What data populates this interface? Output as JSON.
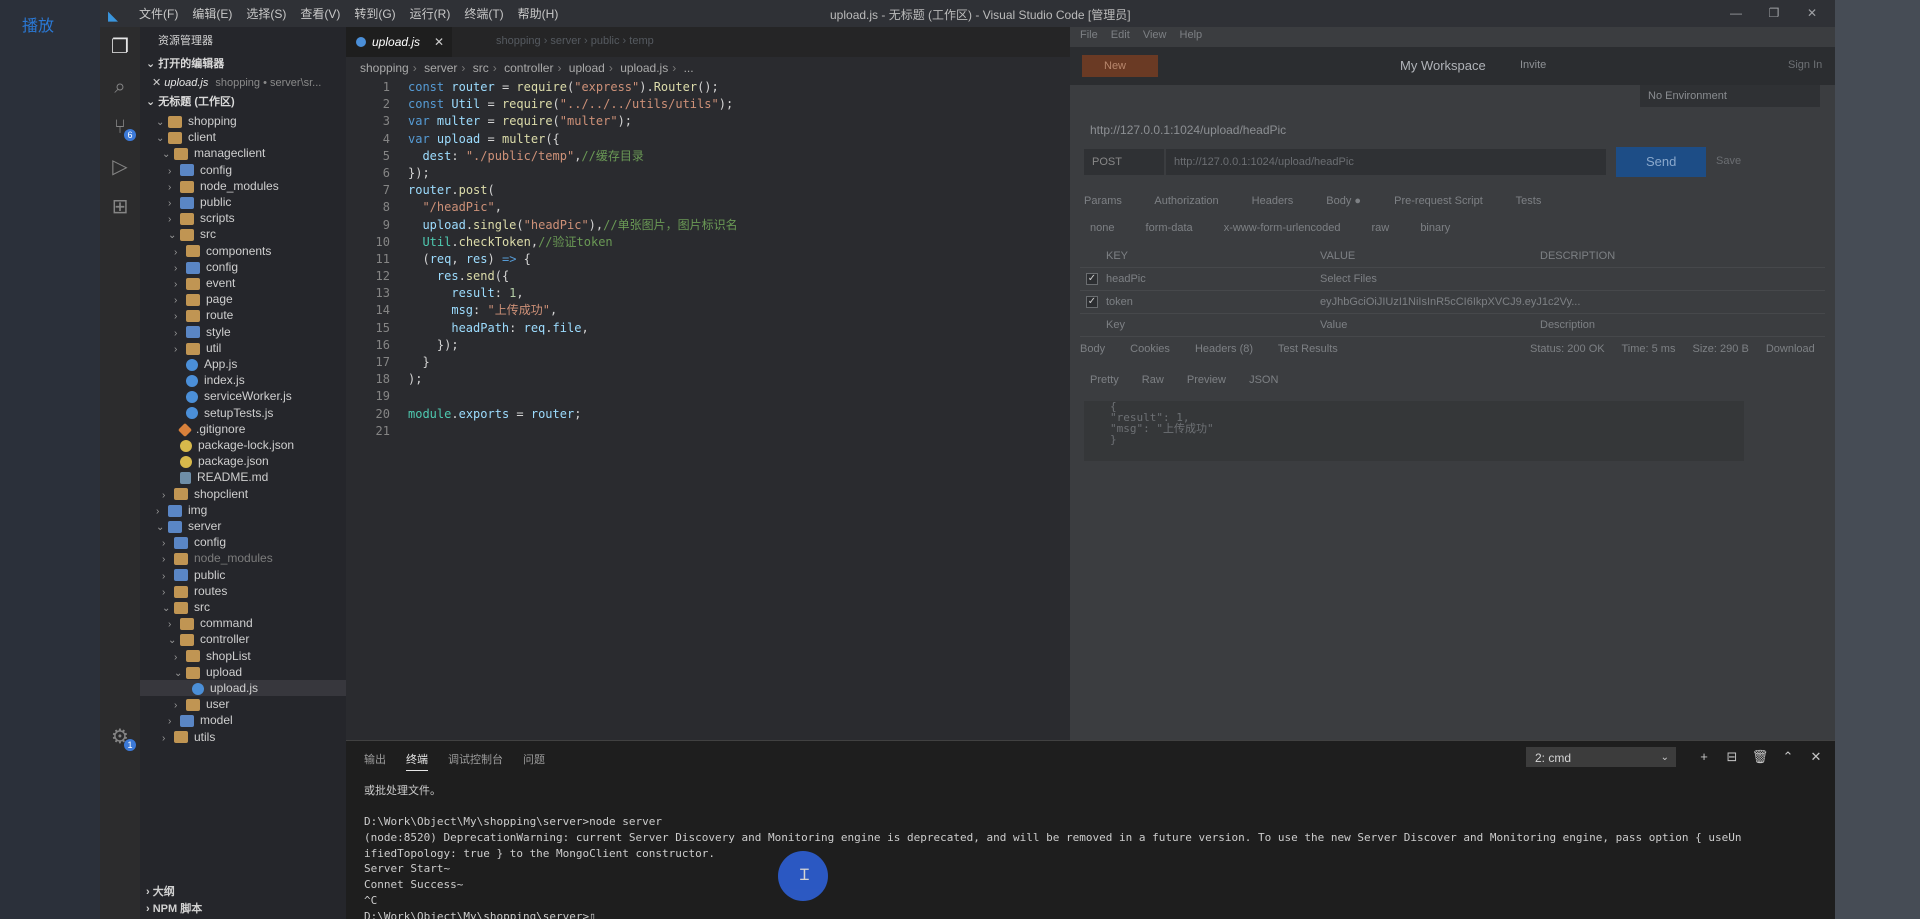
{
  "overlay": {
    "play_label": "播放"
  },
  "titlebar": {
    "menu": [
      "文件(F)",
      "编辑(E)",
      "选择(S)",
      "查看(V)",
      "转到(G)",
      "运行(R)",
      "终端(T)",
      "帮助(H)"
    ],
    "title": "upload.js - 无标题 (工作区) - Visual Studio Code [管理员]",
    "controls": [
      "—",
      "❐",
      "✕"
    ]
  },
  "activitybar": {
    "scm_badge": "6",
    "settings_badge": "1"
  },
  "sidebar": {
    "header": "资源管理器",
    "open_editors_title": "打开的编辑器",
    "open_editor": {
      "name": "upload.js",
      "path": "shopping • server\\sr..."
    },
    "workspace_title": "无标题 (工作区)",
    "tree": [
      {
        "label": "shopping",
        "depth": 1,
        "kind": "folder",
        "chev": "⌄"
      },
      {
        "label": "client",
        "depth": 1,
        "kind": "folder",
        "chev": "⌄"
      },
      {
        "label": "manageclient",
        "depth": 2,
        "kind": "folder",
        "chev": "⌄"
      },
      {
        "label": "config",
        "depth": 3,
        "kind": "folder-blue",
        "chev": "›"
      },
      {
        "label": "node_modules",
        "depth": 3,
        "kind": "folder",
        "chev": "›"
      },
      {
        "label": "public",
        "depth": 3,
        "kind": "folder-blue",
        "chev": "›"
      },
      {
        "label": "scripts",
        "depth": 3,
        "kind": "folder",
        "chev": "›"
      },
      {
        "label": "src",
        "depth": 3,
        "kind": "folder",
        "chev": "⌄"
      },
      {
        "label": "components",
        "depth": 4,
        "kind": "folder",
        "chev": "›"
      },
      {
        "label": "config",
        "depth": 4,
        "kind": "folder-blue",
        "chev": "›"
      },
      {
        "label": "event",
        "depth": 4,
        "kind": "folder",
        "chev": "›"
      },
      {
        "label": "page",
        "depth": 4,
        "kind": "folder",
        "chev": "›"
      },
      {
        "label": "route",
        "depth": 4,
        "kind": "folder",
        "chev": "›"
      },
      {
        "label": "style",
        "depth": 4,
        "kind": "folder-blue",
        "chev": "›"
      },
      {
        "label": "util",
        "depth": 4,
        "kind": "folder",
        "chev": "›"
      },
      {
        "label": "App.js",
        "depth": 4,
        "kind": "js",
        "chev": ""
      },
      {
        "label": "index.js",
        "depth": 4,
        "kind": "js",
        "chev": ""
      },
      {
        "label": "serviceWorker.js",
        "depth": 4,
        "kind": "js",
        "chev": ""
      },
      {
        "label": "setupTests.js",
        "depth": 4,
        "kind": "js",
        "chev": ""
      },
      {
        "label": ".gitignore",
        "depth": 3,
        "kind": "git",
        "chev": ""
      },
      {
        "label": "package-lock.json",
        "depth": 3,
        "kind": "json",
        "chev": ""
      },
      {
        "label": "package.json",
        "depth": 3,
        "kind": "json",
        "chev": ""
      },
      {
        "label": "README.md",
        "depth": 3,
        "kind": "file",
        "chev": ""
      },
      {
        "label": "shopclient",
        "depth": 2,
        "kind": "folder",
        "chev": "›"
      },
      {
        "label": "img",
        "depth": 1,
        "kind": "folder-blue",
        "chev": "›"
      },
      {
        "label": "server",
        "depth": 1,
        "kind": "folder-blue",
        "chev": "⌄"
      },
      {
        "label": "config",
        "depth": 2,
        "kind": "folder-blue",
        "chev": "›"
      },
      {
        "label": "node_modules",
        "depth": 2,
        "kind": "folder",
        "chev": "›",
        "dim": true
      },
      {
        "label": "public",
        "depth": 2,
        "kind": "folder-blue",
        "chev": "›"
      },
      {
        "label": "routes",
        "depth": 2,
        "kind": "folder",
        "chev": "›"
      },
      {
        "label": "src",
        "depth": 2,
        "kind": "folder",
        "chev": "⌄"
      },
      {
        "label": "command",
        "depth": 3,
        "kind": "folder",
        "chev": "›"
      },
      {
        "label": "controller",
        "depth": 3,
        "kind": "folder",
        "chev": "⌄"
      },
      {
        "label": "shopList",
        "depth": 4,
        "kind": "folder",
        "chev": "›"
      },
      {
        "label": "upload",
        "depth": 4,
        "kind": "folder",
        "chev": "⌄"
      },
      {
        "label": "upload.js",
        "depth": 5,
        "kind": "js",
        "chev": "",
        "selected": true
      },
      {
        "label": "user",
        "depth": 4,
        "kind": "folder",
        "chev": "›"
      },
      {
        "label": "model",
        "depth": 3,
        "kind": "folder-blue",
        "chev": "›"
      },
      {
        "label": "utils",
        "depth": 2,
        "kind": "folder",
        "chev": "›"
      }
    ],
    "outline_title": "大纲",
    "npm_title": "NPM 脚本"
  },
  "editor": {
    "tab": {
      "label": "upload.js",
      "close": "✕"
    },
    "ghost_path": "shopping › server › public › temp",
    "breadcrumbs": [
      "shopping",
      "server",
      "src",
      "controller",
      "upload",
      "upload.js",
      "..."
    ],
    "code": [
      "<span class=\"kw\">const</span> <span class=\"var\">router</span> = <span class=\"fn\">require</span>(<span class=\"str\">\"express\"</span>).<span class=\"fn\">Router</span>();",
      "<span class=\"kw\">const</span> <span class=\"var\">Util</span> = <span class=\"fn\">require</span>(<span class=\"str\">\"../../../utils/utils\"</span>);",
      "<span class=\"kw\">var</span> <span class=\"var\">multer</span> = <span class=\"fn\">require</span>(<span class=\"str\">\"multer\"</span>);",
      "<span class=\"kw\">var</span> <span class=\"var\">upload</span> = <span class=\"fn\">multer</span>({",
      "  <span class=\"var\">dest</span>: <span class=\"str\">\"./public/temp\"</span>,<span class=\"cm\">//缓存目录</span>",
      "});",
      "<span class=\"var\">router</span>.<span class=\"fn\">post</span>(",
      "  <span class=\"str\">\"/headPic\"</span>,",
      "  <span class=\"var\">upload</span>.<span class=\"fn\">single</span>(<span class=\"str\">\"headPic\"</span>),<span class=\"cm\">//单张图片，图片标识名</span>",
      "  <span class=\"obj\">Util</span>.<span class=\"fn\">checkToken</span>,<span class=\"cm\">//验证token</span>",
      "  (<span class=\"var\">req</span>, <span class=\"var\">res</span>) <span class=\"kw\">=&gt;</span> {",
      "    <span class=\"var\">res</span>.<span class=\"fn\">send</span>({",
      "      <span class=\"var\">result</span>: <span class=\"num\">1</span>,",
      "      <span class=\"var\">msg</span>: <span class=\"str\">\"上传成功\"</span>,",
      "      <span class=\"var\">headPath</span>: <span class=\"var\">req</span>.<span class=\"var\">file</span>,",
      "    });",
      "  }",
      ");",
      "",
      "<span class=\"obj\">module</span>.<span class=\"var\">exports</span> = <span class=\"var\">router</span>;",
      ""
    ]
  },
  "postman": {
    "menu": [
      "File",
      "Edit",
      "View",
      "Help"
    ],
    "new_label": "New",
    "workspace": "My Workspace",
    "invite": "Invite",
    "signin": "Sign In",
    "environment": "No Environment",
    "request_title": "http://127.0.0.1:1024/upload/headPic",
    "method": "POST",
    "url": "http://127.0.0.1:1024/upload/headPic",
    "send": "Send",
    "save": "Save",
    "request_tabs": [
      "Params",
      "Authorization",
      "Headers",
      "Body ●",
      "Pre-request Script",
      "Tests"
    ],
    "body_modes": [
      "none",
      "form-data",
      "x-www-form-urlencoded",
      "raw",
      "binary"
    ],
    "table_headers": [
      "KEY",
      "VALUE",
      "DESCRIPTION"
    ],
    "rows": [
      {
        "key": "headPic",
        "value": "Select Files",
        "checked": true
      },
      {
        "key": "token",
        "value": "eyJhbGciOiJIUzI1NiIsInR5cCI6IkpXVCJ9.eyJ1c2Vy...",
        "checked": true
      },
      {
        "key": "Key",
        "value": "Value",
        "checked": false,
        "desc": "Description"
      }
    ],
    "response_tabs": [
      "Body",
      "Cookies",
      "Headers (8)",
      "Test Results"
    ],
    "status": [
      "Status: 200 OK",
      "Time: 5 ms",
      "Size: 290 B",
      "Download"
    ],
    "response_tools": [
      "Pretty",
      "Raw",
      "Preview",
      "JSON"
    ],
    "response_json": [
      "{",
      "    \"result\": 1,",
      "    \"msg\": \"上传成功\"",
      "}"
    ]
  },
  "panel": {
    "tabs": [
      "输出",
      "终端",
      "调试控制台",
      "问题"
    ],
    "active_tab": "终端",
    "terminal_select": "2: cmd",
    "icons": [
      "+",
      "⊟",
      "🗑",
      "⌃",
      "✕"
    ],
    "terminal_lines": [
      "或批处理文件。",
      "",
      "D:\\Work\\Object\\My\\shopping\\server>node server",
      "(node:8520) DeprecationWarning: current Server Discovery and Monitoring engine is deprecated, and will be removed in a future version. To use the new Server Discover and Monitoring engine, pass option { useUn",
      "ifiedTopology: true } to the MongoClient constructor.",
      "Server Start~",
      "Connet Success~",
      "^C",
      "D:\\Work\\Object\\My\\shopping\\server>▯"
    ]
  }
}
